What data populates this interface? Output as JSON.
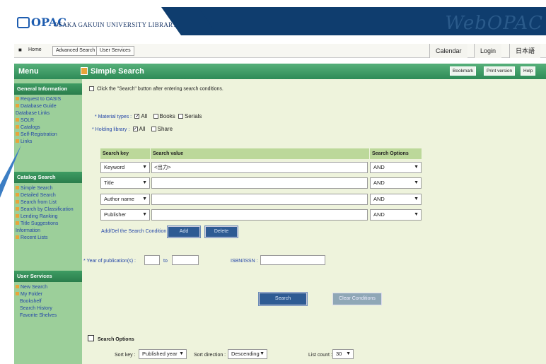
{
  "header": {
    "logo_text": "OPAC",
    "library_name": "OSAKA GAKUIN UNIVERSITY LIBRARY",
    "brand_text": "WebOPAC"
  },
  "nav": {
    "home": "Home",
    "links": [
      "Advanced Search",
      "User Services"
    ],
    "calendar": "Calendar",
    "login": "Login",
    "lang": "日本語"
  },
  "menu": {
    "title": "Menu",
    "sections": [
      {
        "heading": "General Information",
        "items": [
          "Request to OASIS",
          "Database Guide",
          "Database Links",
          "SOLR",
          "Catalogs",
          "Self-Registration",
          "Links"
        ]
      },
      {
        "heading": "Catalog Search",
        "items": [
          "Simple Search",
          "Detailed Search",
          "Search from List",
          "Search by Classification",
          "Lending Ranking",
          "Title Suggestions",
          "Information",
          "Recent Lists"
        ]
      },
      {
        "heading": "User Services",
        "items": [
          "New Search",
          "My Folder",
          "Bookshelf",
          "Search History",
          "Favorite Shelves"
        ]
      }
    ]
  },
  "page": {
    "title": "Simple Search",
    "tool_buttons": [
      "Bookmark",
      "Print version",
      "Help"
    ],
    "instruction": "Click the \"Search\" button after entering search conditions."
  },
  "filters": {
    "material_label": "* Material types :",
    "material_opts": [
      "All",
      "Books",
      "Serials"
    ],
    "holding_label": "* Holding library :",
    "holding_opts": [
      "All",
      "Share"
    ]
  },
  "grid": {
    "headers": [
      "Search key",
      "Search value",
      "Search Options"
    ],
    "rows": [
      {
        "key": "Keyword",
        "value": "<出力>",
        "op": "AND"
      },
      {
        "key": "Title",
        "value": "",
        "op": "AND"
      },
      {
        "key": "Author name",
        "value": "",
        "op": "AND"
      },
      {
        "key": "Publisher",
        "value": "",
        "op": "AND"
      }
    ],
    "add_label": "Add/Del the Search Condition :",
    "add_btn": "Add",
    "del_btn": "Delete"
  },
  "extra": {
    "year_label": "* Year of publication(s) :",
    "year_sep": "to",
    "isbn_label": "ISBN/ISSN :"
  },
  "actions": {
    "search": "Search",
    "clear": "Clear Conditions"
  },
  "options": {
    "title": "Search Options",
    "sort_label": "Sort key :",
    "sort_value": "Published year",
    "order_label": "Sort direction :",
    "order_value": "Descending",
    "count_label": "List count :",
    "count_value": "30"
  }
}
